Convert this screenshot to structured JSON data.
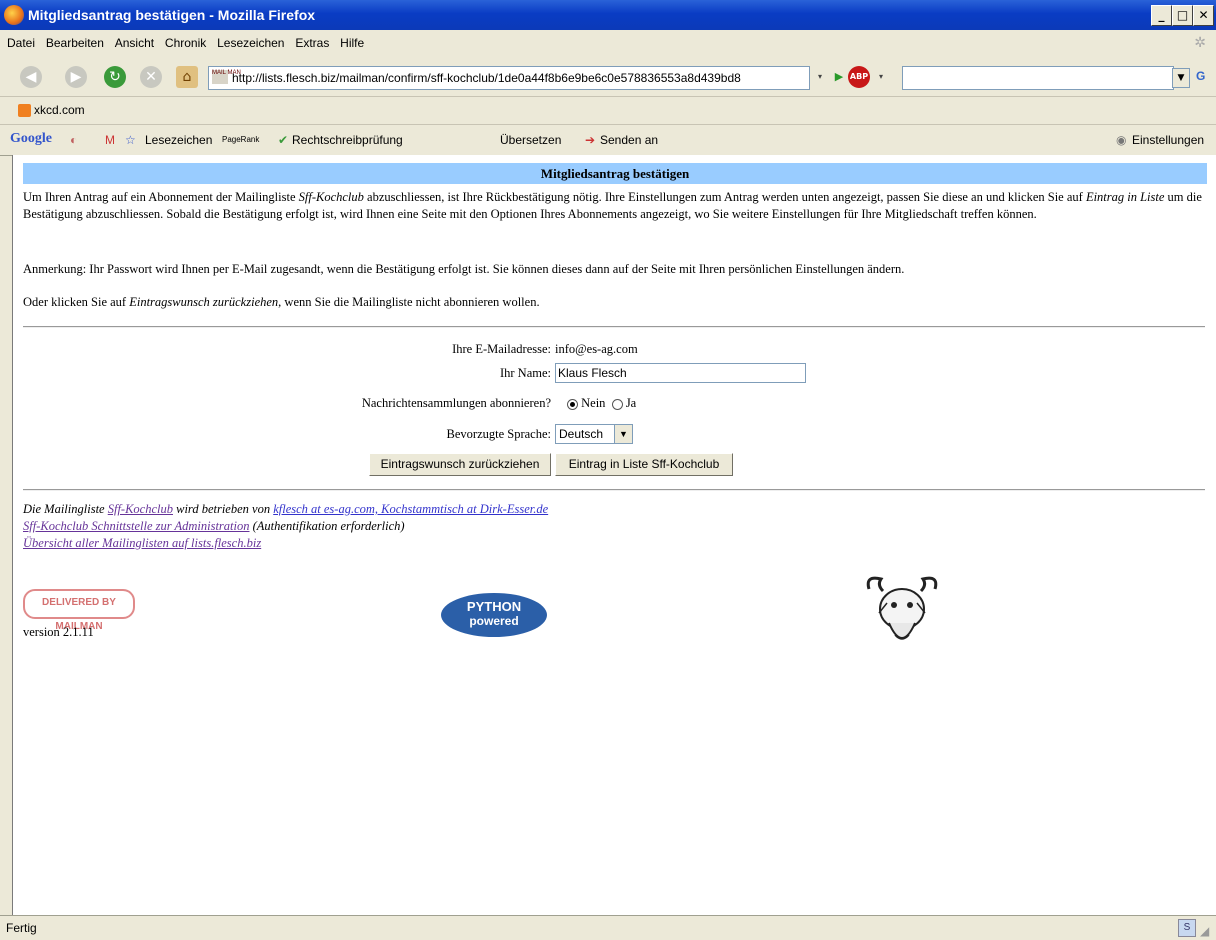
{
  "window": {
    "title": "Mitgliedsantrag bestätigen - Mozilla Firefox"
  },
  "menu": [
    "Datei",
    "Bearbeiten",
    "Ansicht",
    "Chronik",
    "Lesezeichen",
    "Extras",
    "Hilfe"
  ],
  "nav": {
    "url": "http://lists.flesch.biz/mailman/confirm/sff-kochclub/1de0a44f8b6e9be6c0e578836553a8d439bd8",
    "search_placeholder": "",
    "search_engine": "G",
    "favicon_text": "MAIL MAN"
  },
  "bookmarks": {
    "item": "xkcd.com"
  },
  "googlebar": {
    "logo": "Google",
    "bookmarks": "Lesezeichen",
    "pagerank": "PageRank",
    "spellcheck": "Rechtschreibprüfung",
    "translate": "Übersetzen",
    "send": "Senden an",
    "settings": "Einstellungen"
  },
  "page": {
    "heading": "Mitgliedsantrag bestätigen",
    "intro_1": "Um Ihren Antrag auf ein Abonnement der Mailingliste ",
    "intro_list": "Sff-Kochclub",
    "intro_2": " abzuschliessen, ist Ihre Rückbestätigung nötig. Ihre Einstellungen zum Antrag werden unten angezeigt, passen Sie diese an und klicken Sie auf ",
    "intro_btn": "Eintrag in Liste",
    "intro_3": " um die Bestätigung abzuschliessen. Sobald die Bestätigung erfolgt ist, wird Ihnen eine Seite mit den Optionen Ihres Abonnements angezeigt, wo Sie weitere Einstellungen für Ihre Mitgliedschaft treffen können.",
    "note": "Anmerkung: Ihr Passwort wird Ihnen per E-Mail zugesandt, wenn die Bestätigung erfolgt ist. Sie können dieses dann auf der Seite mit Ihren persönlichen Einstellungen ändern.",
    "cancel_1": "Oder klicken Sie auf ",
    "cancel_em": "Eintragswunsch zurückziehen",
    "cancel_2": ", wenn Sie die Mailingliste nicht abonnieren wollen.",
    "email_label": "Ihre E-Mailadresse:",
    "email_value": "info@es-ag.com",
    "name_label": "Ihr Name:",
    "name_value": "Klaus Flesch",
    "digest_label": "Nachrichtensammlungen abonnieren?",
    "digest_no": "Nein",
    "digest_yes": "Ja",
    "lang_label": "Bevorzugte Sprache:",
    "lang_value": "Deutsch",
    "btn_cancel": "Eintragswunsch zurückziehen",
    "btn_submit": "Eintrag in Liste Sff-Kochclub"
  },
  "footer": {
    "line1_a": "Die Mailingliste ",
    "line1_link": "Sff-Kochclub",
    "line1_b": " wird betrieben von ",
    "line1_owners": "kflesch at es-ag.com, Kochstammtisch at Dirk-Esser.de",
    "line2_link": "Sff-Kochclub Schnittstelle zur Administration",
    "line2_b": " (Authentifikation erforderlich)",
    "line3_link": "Übersicht aller Mailinglisten auf lists.flesch.biz",
    "mailman_logo": "DELIVERED BY MAILMAN",
    "version": "version 2.1.11",
    "python_logo_1": "PYTHON",
    "python_logo_2": "powered"
  },
  "status": {
    "text": "Fertig"
  }
}
